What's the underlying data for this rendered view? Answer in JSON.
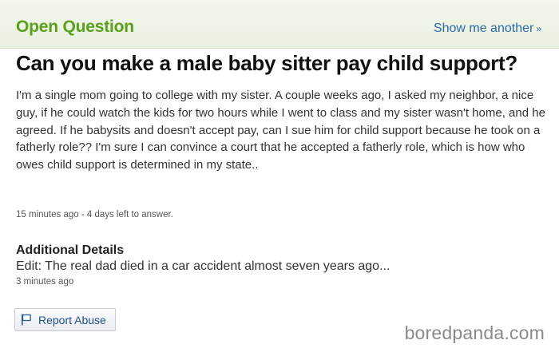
{
  "header": {
    "section_label": "Open Question",
    "show_another_label": "Show me another",
    "show_another_chevron": "»"
  },
  "question": {
    "title": "Can you make a male baby sitter pay child support?",
    "body": "I'm a single mom going to college with my sister. A couple weeks ago, I asked my neighbor, a nice guy, if he could watch the kids for two hours while I went to class and my sister wasn't home, and he agreed. If he babysits and doesn't accept pay, can I sue him for child support because he took on a fatherly role?? I'm sure I can convince a court that he accepted a fatherly role, which is how who owes child support is determined in my state..",
    "meta": "15 minutes ago - 4 days left to answer."
  },
  "additional_details": {
    "heading": "Additional Details",
    "text": "Edit: The real dad died in a car accident almost seven years ago...",
    "time": "3 minutes ago"
  },
  "actions": {
    "report_abuse_label": "Report Abuse",
    "report_icon": "flag-icon"
  },
  "watermark": "boredpanda.com",
  "colors": {
    "accent_green": "#5aa01c",
    "link_blue": "#2d6aa8",
    "header_bg": "#eef3e7"
  }
}
